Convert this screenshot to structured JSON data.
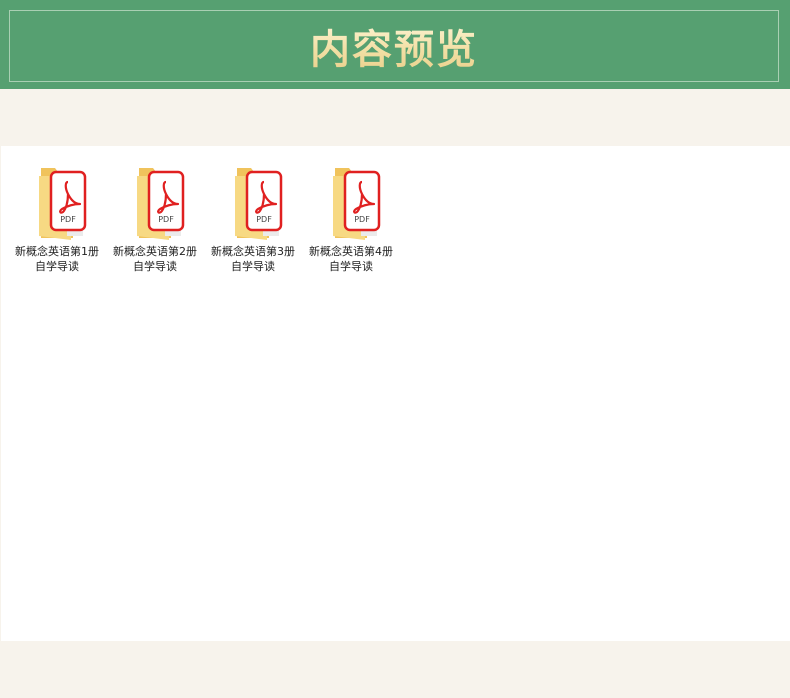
{
  "header": {
    "title": "内容预览"
  },
  "files": [
    {
      "line1": "新概念英语第1册",
      "line2": "自学导读",
      "icon": "pdf-folder-icon",
      "badge": "PDF"
    },
    {
      "line1": "新概念英语第2册",
      "line2": "自学导读",
      "icon": "pdf-folder-icon",
      "badge": "PDF"
    },
    {
      "line1": "新概念英语第3册",
      "line2": "自学导读",
      "icon": "pdf-folder-icon",
      "badge": "PDF"
    },
    {
      "line1": "新概念英语第4册",
      "line2": "自学导读",
      "icon": "pdf-folder-icon",
      "badge": "PDF"
    }
  ],
  "colors": {
    "header_bg": "#56a071",
    "title": "#f6e3b0",
    "page_bg": "#f7f3ec",
    "pdf_red": "#e02020",
    "folder": "#f6d47a"
  }
}
